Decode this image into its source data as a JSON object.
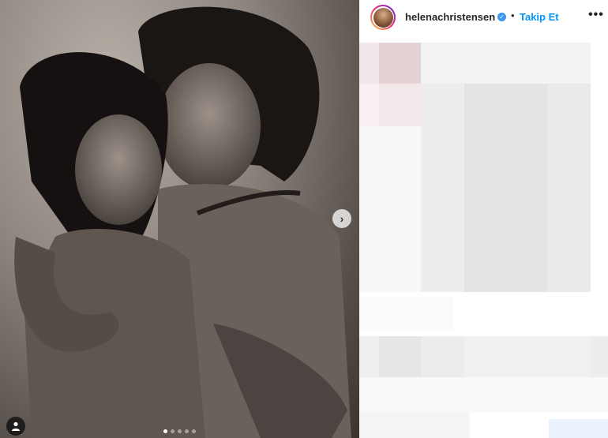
{
  "post": {
    "username": "helenachristensen",
    "verified": true,
    "separator": "•",
    "follow_label": "Takip Et",
    "more_label": "•••"
  },
  "carousel": {
    "slide_count": 5,
    "active_index": 0,
    "next_glyph": "›"
  },
  "icons": {
    "verified": "verified-badge-icon",
    "next": "chevron-right-icon",
    "user_tag": "user-tag-icon",
    "more": "more-options-icon"
  },
  "colors": {
    "follow": "#0095f6",
    "verified": "#3897f0",
    "text": "#262626"
  }
}
